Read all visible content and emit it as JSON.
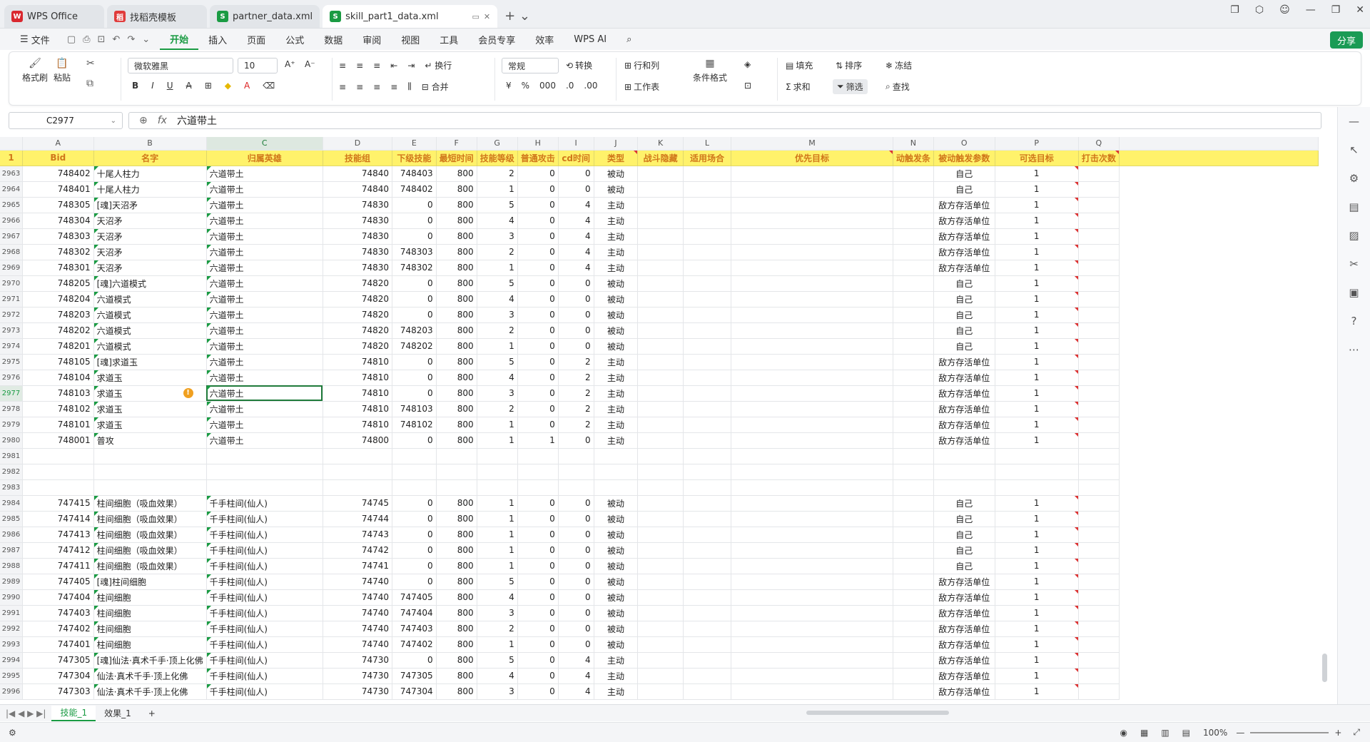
{
  "tabs": [
    {
      "label": "WPS Office",
      "badge": "W",
      "color": "#d9282f"
    },
    {
      "label": "找稻壳模板",
      "badge": "稻",
      "color": "#e03b3b"
    },
    {
      "label": "partner_data.xml",
      "badge": "S",
      "color": "#1a9b43"
    },
    {
      "label": "skill_part1_data.xml",
      "badge": "S",
      "color": "#1a9b43"
    }
  ],
  "menu": {
    "file": "文件",
    "items": [
      "开始",
      "插入",
      "页面",
      "公式",
      "数据",
      "审阅",
      "视图",
      "工具",
      "会员专享",
      "效率"
    ],
    "active": "开始",
    "wpsai": "WPS AI",
    "share": "分享"
  },
  "ribbon": {
    "format_painter": "格式刷",
    "paste": "粘贴",
    "font": "微软雅黑",
    "size": "10",
    "wrap": "换行",
    "merge": "合并",
    "numfmt": "常规",
    "convert": "转换",
    "rowcol": "行和列",
    "worksheet": "工作表",
    "condfmt": "条件格式",
    "fill": "填充",
    "sort": "排序",
    "freeze": "冻结",
    "sum": "求和",
    "filter": "筛选",
    "find": "查找"
  },
  "formula": {
    "cell": "C2977",
    "fx": "fx",
    "value": "六道带土"
  },
  "columns": [
    "A",
    "B",
    "C",
    "D",
    "E",
    "F",
    "G",
    "H",
    "I",
    "J",
    "K",
    "L",
    "M",
    "N",
    "O",
    "P",
    "Q"
  ],
  "headers": [
    "Bid",
    "名字",
    "归属英雄",
    "技能组",
    "下级技能",
    "最短时间",
    "技能等级",
    "普通攻击",
    "cd时间",
    "类型",
    "战斗隐藏",
    "适用场合",
    "优先目标",
    "动触发条",
    "被动触发参数",
    "可选目标",
    "打击次数"
  ],
  "rows": [
    [
      "2963",
      "748402",
      "十尾人柱力",
      "六道带土",
      "74840",
      "748403",
      "800",
      "2",
      "0",
      "0",
      "被动",
      "",
      "",
      "",
      "",
      "自己",
      "1"
    ],
    [
      "2964",
      "748401",
      "十尾人柱力",
      "六道带土",
      "74840",
      "748402",
      "800",
      "1",
      "0",
      "0",
      "被动",
      "",
      "",
      "",
      "",
      "自己",
      "1"
    ],
    [
      "2965",
      "748305",
      "[魂]天沼矛",
      "六道带土",
      "74830",
      "0",
      "800",
      "5",
      "0",
      "4",
      "主动",
      "",
      "",
      "",
      "",
      "敌方存活单位",
      "1"
    ],
    [
      "2966",
      "748304",
      "天沼矛",
      "六道带土",
      "74830",
      "0",
      "800",
      "4",
      "0",
      "4",
      "主动",
      "",
      "",
      "",
      "",
      "敌方存活单位",
      "1"
    ],
    [
      "2967",
      "748303",
      "天沼矛",
      "六道带土",
      "74830",
      "0",
      "800",
      "3",
      "0",
      "4",
      "主动",
      "",
      "",
      "",
      "",
      "敌方存活单位",
      "1"
    ],
    [
      "2968",
      "748302",
      "天沼矛",
      "六道带土",
      "74830",
      "748303",
      "800",
      "2",
      "0",
      "4",
      "主动",
      "",
      "",
      "",
      "",
      "敌方存活单位",
      "1"
    ],
    [
      "2969",
      "748301",
      "天沼矛",
      "六道带土",
      "74830",
      "748302",
      "800",
      "1",
      "0",
      "4",
      "主动",
      "",
      "",
      "",
      "",
      "敌方存活单位",
      "1"
    ],
    [
      "2970",
      "748205",
      "[魂]六道模式",
      "六道带土",
      "74820",
      "0",
      "800",
      "5",
      "0",
      "0",
      "被动",
      "",
      "",
      "",
      "",
      "自己",
      "1"
    ],
    [
      "2971",
      "748204",
      "六道模式",
      "六道带土",
      "74820",
      "0",
      "800",
      "4",
      "0",
      "0",
      "被动",
      "",
      "",
      "",
      "",
      "自己",
      "1"
    ],
    [
      "2972",
      "748203",
      "六道模式",
      "六道带土",
      "74820",
      "0",
      "800",
      "3",
      "0",
      "0",
      "被动",
      "",
      "",
      "",
      "",
      "自己",
      "1"
    ],
    [
      "2973",
      "748202",
      "六道模式",
      "六道带土",
      "74820",
      "748203",
      "800",
      "2",
      "0",
      "0",
      "被动",
      "",
      "",
      "",
      "",
      "自己",
      "1"
    ],
    [
      "2974",
      "748201",
      "六道模式",
      "六道带土",
      "74820",
      "748202",
      "800",
      "1",
      "0",
      "0",
      "被动",
      "",
      "",
      "",
      "",
      "自己",
      "1"
    ],
    [
      "2975",
      "748105",
      "[魂]求道玉",
      "六道带土",
      "74810",
      "0",
      "800",
      "5",
      "0",
      "2",
      "主动",
      "",
      "",
      "",
      "",
      "敌方存活单位",
      "1"
    ],
    [
      "2976",
      "748104",
      "求道玉",
      "六道带土",
      "74810",
      "0",
      "800",
      "4",
      "0",
      "2",
      "主动",
      "",
      "",
      "",
      "",
      "敌方存活单位",
      "1"
    ],
    [
      "2977",
      "748103",
      "求道玉",
      "六道带土",
      "74810",
      "0",
      "800",
      "3",
      "0",
      "2",
      "主动",
      "",
      "",
      "",
      "",
      "敌方存活单位",
      "1"
    ],
    [
      "2978",
      "748102",
      "求道玉",
      "六道带土",
      "74810",
      "748103",
      "800",
      "2",
      "0",
      "2",
      "主动",
      "",
      "",
      "",
      "",
      "敌方存活单位",
      "1"
    ],
    [
      "2979",
      "748101",
      "求道玉",
      "六道带土",
      "74810",
      "748102",
      "800",
      "1",
      "0",
      "2",
      "主动",
      "",
      "",
      "",
      "",
      "敌方存活单位",
      "1"
    ],
    [
      "2980",
      "748001",
      "普攻",
      "六道带土",
      "74800",
      "0",
      "800",
      "1",
      "1",
      "0",
      "主动",
      "",
      "",
      "",
      "",
      "敌方存活单位",
      "1"
    ],
    [
      "2981",
      "",
      "",
      "",
      "",
      "",
      "",
      "",
      "",
      "",
      "",
      "",
      "",
      "",
      "",
      "",
      ""
    ],
    [
      "2982",
      "",
      "",
      "",
      "",
      "",
      "",
      "",
      "",
      "",
      "",
      "",
      "",
      "",
      "",
      "",
      ""
    ],
    [
      "2983",
      "",
      "",
      "",
      "",
      "",
      "",
      "",
      "",
      "",
      "",
      "",
      "",
      "",
      "",
      "",
      ""
    ],
    [
      "2984",
      "747415",
      "柱间细胞（吸血效果）",
      "千手柱间(仙人)",
      "74745",
      "0",
      "800",
      "1",
      "0",
      "0",
      "被动",
      "",
      "",
      "",
      "",
      "自己",
      "1"
    ],
    [
      "2985",
      "747414",
      "柱间细胞（吸血效果）",
      "千手柱间(仙人)",
      "74744",
      "0",
      "800",
      "1",
      "0",
      "0",
      "被动",
      "",
      "",
      "",
      "",
      "自己",
      "1"
    ],
    [
      "2986",
      "747413",
      "柱间细胞（吸血效果）",
      "千手柱间(仙人)",
      "74743",
      "0",
      "800",
      "1",
      "0",
      "0",
      "被动",
      "",
      "",
      "",
      "",
      "自己",
      "1"
    ],
    [
      "2987",
      "747412",
      "柱间细胞（吸血效果）",
      "千手柱间(仙人)",
      "74742",
      "0",
      "800",
      "1",
      "0",
      "0",
      "被动",
      "",
      "",
      "",
      "",
      "自己",
      "1"
    ],
    [
      "2988",
      "747411",
      "柱间细胞（吸血效果）",
      "千手柱间(仙人)",
      "74741",
      "0",
      "800",
      "1",
      "0",
      "0",
      "被动",
      "",
      "",
      "",
      "",
      "自己",
      "1"
    ],
    [
      "2989",
      "747405",
      "[魂]柱间细胞",
      "千手柱间(仙人)",
      "74740",
      "0",
      "800",
      "5",
      "0",
      "0",
      "被动",
      "",
      "",
      "",
      "",
      "敌方存活单位",
      "1"
    ],
    [
      "2990",
      "747404",
      "柱间细胞",
      "千手柱间(仙人)",
      "74740",
      "747405",
      "800",
      "4",
      "0",
      "0",
      "被动",
      "",
      "",
      "",
      "",
      "敌方存活单位",
      "1"
    ],
    [
      "2991",
      "747403",
      "柱间细胞",
      "千手柱间(仙人)",
      "74740",
      "747404",
      "800",
      "3",
      "0",
      "0",
      "被动",
      "",
      "",
      "",
      "",
      "敌方存活单位",
      "1"
    ],
    [
      "2992",
      "747402",
      "柱间细胞",
      "千手柱间(仙人)",
      "74740",
      "747403",
      "800",
      "2",
      "0",
      "0",
      "被动",
      "",
      "",
      "",
      "",
      "敌方存活单位",
      "1"
    ],
    [
      "2993",
      "747401",
      "柱间细胞",
      "千手柱间(仙人)",
      "74740",
      "747402",
      "800",
      "1",
      "0",
      "0",
      "被动",
      "",
      "",
      "",
      "",
      "敌方存活单位",
      "1"
    ],
    [
      "2994",
      "747305",
      "[魂]仙法·真术千手·顶上化佛",
      "千手柱间(仙人)",
      "74730",
      "0",
      "800",
      "5",
      "0",
      "4",
      "主动",
      "",
      "",
      "",
      "",
      "敌方存活单位",
      "1"
    ],
    [
      "2995",
      "747304",
      "仙法·真术千手·顶上化佛",
      "千手柱间(仙人)",
      "74730",
      "747305",
      "800",
      "4",
      "0",
      "4",
      "主动",
      "",
      "",
      "",
      "",
      "敌方存活单位",
      "1"
    ],
    [
      "2996",
      "747303",
      "仙法·真术千手·顶上化佛",
      "千手柱间(仙人)",
      "74730",
      "747304",
      "800",
      "3",
      "0",
      "4",
      "主动",
      "",
      "",
      "",
      "",
      "敌方存活单位",
      "1"
    ]
  ],
  "sheets": [
    "技能_1",
    "效果_1"
  ],
  "status": {
    "zoom": "100%"
  }
}
